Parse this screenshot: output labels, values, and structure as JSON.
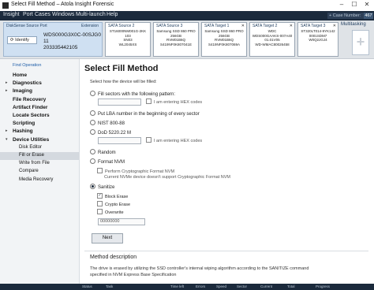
{
  "titlebar": {
    "title": "Select Fill Method  –  Atola Insight Forensic",
    "minimize": "–",
    "maximize": "☐",
    "close": "✕"
  },
  "menubar": {
    "items": [
      "Insight",
      "Port",
      "Cases",
      "Windows",
      "Multi-launch",
      "Help"
    ],
    "case_label": "+ Case Number:",
    "case_number": "467"
  },
  "source": {
    "title": "DiskSense Source Port",
    "extension": "Extension",
    "identify": "Identify",
    "serial_lines": [
      "WDS000G3X0C-00SJG0 11",
      "203335442105"
    ]
  },
  "targets": [
    {
      "title": "SATA Source 2",
      "info": "ST16000NM001G-2KK\n103\nSN03\nWL2045XS"
    },
    {
      "title": "SATA Source 3",
      "info": "Samsung SSD 860 PRO\n256GB\nRVM01B6Q\nS419NF0K807041E"
    },
    {
      "title": "SATA Target 1",
      "info": "Samsung SSD 860 PRO\n256GB\nRVM01B6Q\nS419NF0K807069A"
    },
    {
      "title": "SATA Target 2",
      "info": "WDC\nWDS000GAAKS-007A40\n01.01V05\nWD-WMAC80026458"
    },
    {
      "title": "SATA Target 3",
      "info": "ST320LT014-9YK142\n0001SDM7\nW0Q2JGJ4"
    }
  ],
  "multitasking": "Multitasking",
  "sidebar": {
    "link": "Find Operation",
    "items": [
      {
        "label": "Home",
        "level": 0,
        "arrow": ""
      },
      {
        "label": "Diagnostics",
        "level": 0,
        "arrow": "▸"
      },
      {
        "label": "Imaging",
        "level": 0,
        "arrow": "▸"
      },
      {
        "label": "File Recovery",
        "level": 0,
        "arrow": ""
      },
      {
        "label": "Artifact Finder",
        "level": 0,
        "arrow": ""
      },
      {
        "label": "Locate Sectors",
        "level": 0,
        "arrow": ""
      },
      {
        "label": "Scripting",
        "level": 0,
        "arrow": ""
      },
      {
        "label": "Hashing",
        "level": 0,
        "arrow": "▸"
      },
      {
        "label": "Device Utilities",
        "level": 0,
        "arrow": "▾"
      },
      {
        "label": "Disk Editor",
        "level": 1,
        "arrow": ""
      },
      {
        "label": "Fill or Erase",
        "level": 1,
        "arrow": "",
        "active": true
      },
      {
        "label": "Write from File",
        "level": 1,
        "arrow": ""
      },
      {
        "label": "Compare",
        "level": 1,
        "arrow": ""
      },
      {
        "label": "Media Recovery",
        "level": 1,
        "arrow": ""
      }
    ]
  },
  "main": {
    "title": "Select Fill Method",
    "prompt": "Select how the device will be filled:",
    "options": {
      "fill_pattern": "Fill sectors with the following pattern:",
      "hex_codes": "I am entering HEX codes",
      "lba": "Put LBA number in the beginning of every sector",
      "nist": "NIST 800-88",
      "dod": "DoD 5220.22 M",
      "hex_codes_2": "I am entering HEX codes",
      "random": "Random",
      "format_nvm": "Format NVM",
      "perform_crypto": "Perform Cryptographic Format NVM",
      "nvme_note": "Current NVMe device doesn't support Cryptographic Format NVM",
      "sanitize": "Sanitize",
      "block_erase": "Block Erase",
      "crypto_erase": "Crypto Erase",
      "overwrite": "Overwrite",
      "overwrite_pattern": "00000000"
    },
    "next": "Next",
    "desc_title": "Method description",
    "desc_text": "The drive is erased by utilizing the SSD controller's internal wiping algorithm according to the SANITIZE command specified in NVM Express Base Specification"
  },
  "status": {
    "items": [
      "Status",
      "Task",
      "Time left",
      "Errors",
      "Speed",
      "Sector",
      "Current",
      "Total",
      "Progress"
    ]
  }
}
